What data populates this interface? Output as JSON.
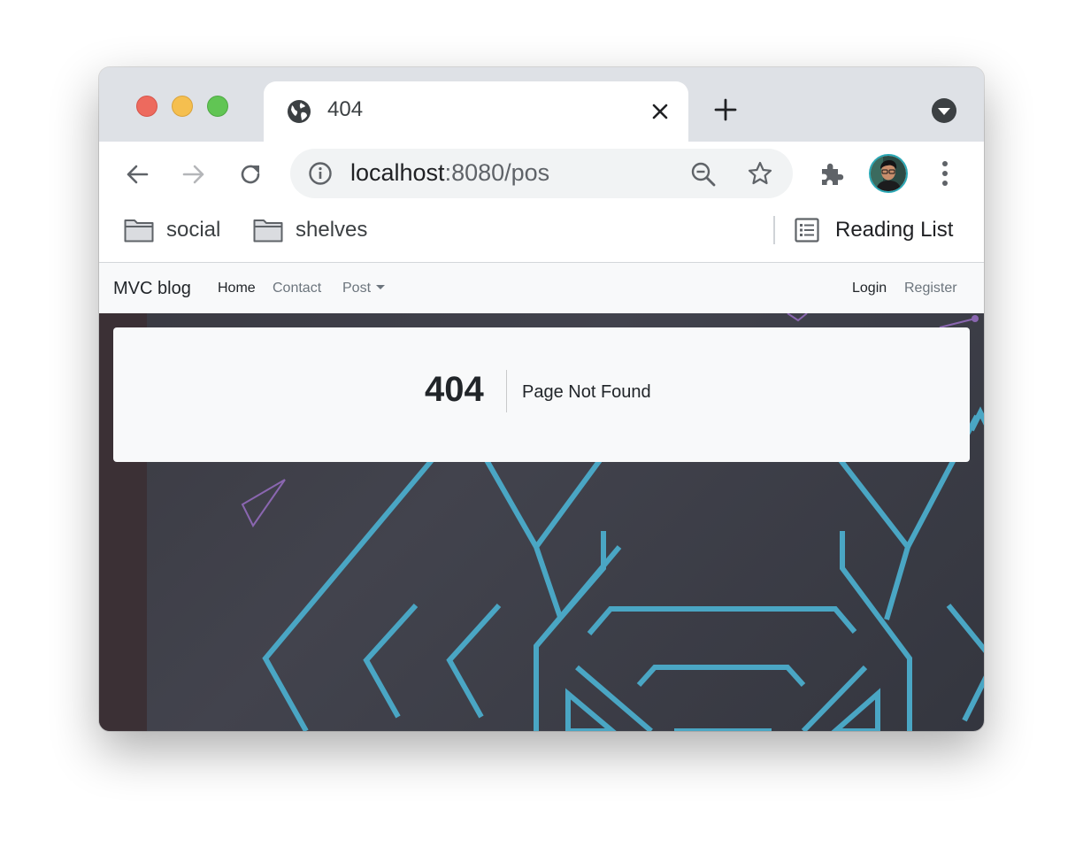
{
  "browser": {
    "tab": {
      "title": "404",
      "icon": "globe-icon"
    },
    "url": {
      "host": "localhost",
      "rest": ":8080/pos"
    },
    "bookmarks": [
      {
        "label": "social",
        "icon": "folder-icon"
      },
      {
        "label": "shelves",
        "icon": "folder-icon"
      }
    ],
    "reading_list": "Reading List"
  },
  "site": {
    "brand": "MVC blog",
    "nav": {
      "home": "Home",
      "contact": "Contact",
      "post": "Post",
      "login": "Login",
      "register": "Register"
    }
  },
  "error": {
    "code": "404",
    "message": "Page Not Found"
  },
  "colors": {
    "accent_line": "#4aa6c4",
    "accent_triangle": "#8a66b0",
    "navbar_bg": "#f8f9fa",
    "content_bg": "#3a3a42"
  }
}
